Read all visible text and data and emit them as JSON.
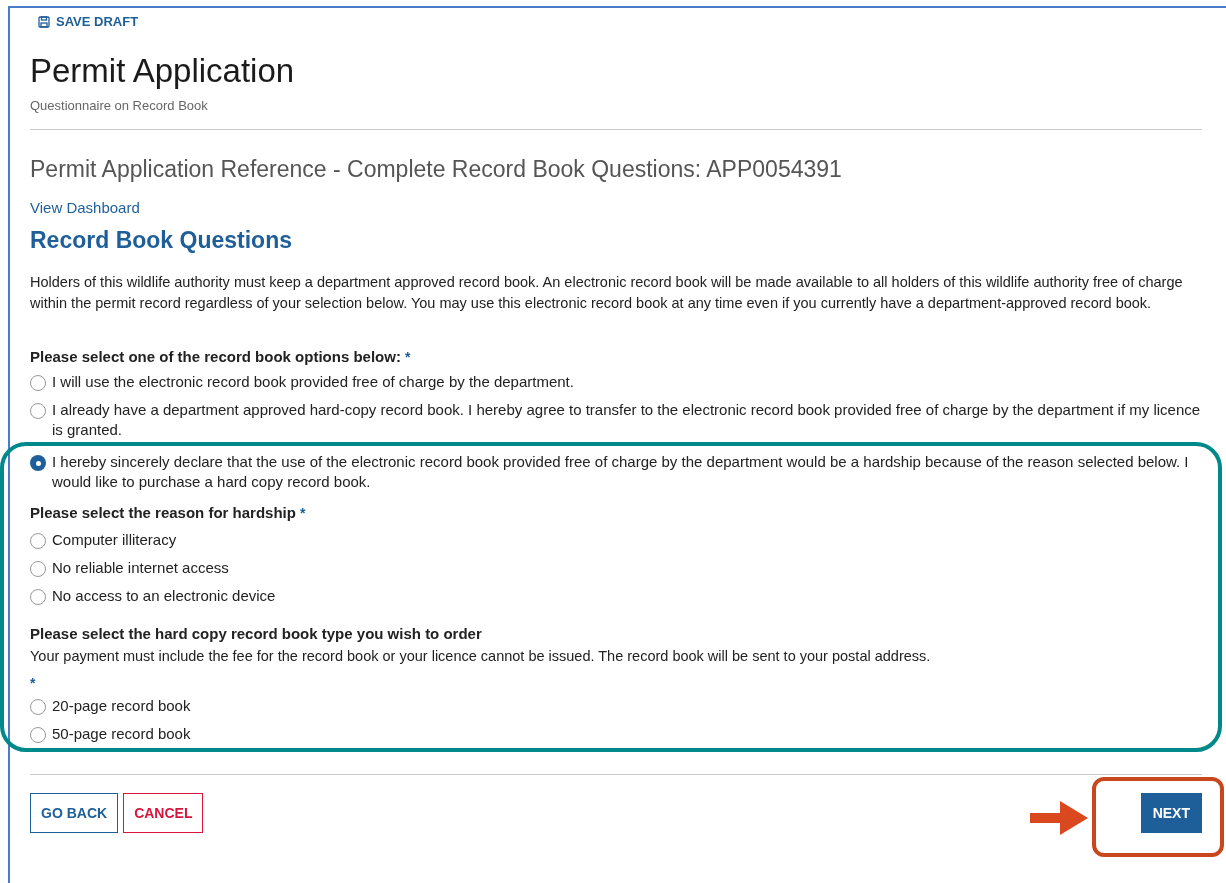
{
  "save_draft": "SAVE DRAFT",
  "title": "Permit Application",
  "subtitle": "Questionnaire on Record Book",
  "reference_heading": "Permit Application Reference - Complete Record Book Questions: APP0054391",
  "dashboard_link": "View Dashboard",
  "section_title": "Record Book Questions",
  "intro": "Holders of this wildlife authority must keep a department approved record book. An electronic record book will be made available to all holders of this wildlife authority free of charge within the permit record regardless of your selection below. You may use this electronic record book at any time even if you currently have a department-approved record book.",
  "record_book_question": {
    "label": "Please select one of the record book options below:",
    "required_mark": "*",
    "options": [
      {
        "label": "I will use the electronic record book provided free of charge by the department.",
        "selected": false
      },
      {
        "label": "I already have a department approved hard-copy record book. I hereby agree to transfer to the electronic record book provided free of charge by the department if my licence is granted.",
        "selected": false
      },
      {
        "label": "I hereby sincerely declare that the use of the electronic record book provided free of charge by the department would be a hardship because of the reason selected below. I would like to purchase a hard copy record book.",
        "selected": true
      }
    ]
  },
  "hardship_question": {
    "label": "Please select the reason for hardship",
    "required_mark": "*",
    "options": [
      {
        "label": "Computer illiteracy",
        "selected": false
      },
      {
        "label": "No reliable internet access",
        "selected": false
      },
      {
        "label": "No access to an electronic device",
        "selected": false
      }
    ]
  },
  "book_type_question": {
    "label": "Please select the hard copy record book type you wish to order",
    "note": "Your payment must include the fee for the record book or your licence cannot be issued. The record book will be sent to your postal address.",
    "required_mark": "*",
    "options": [
      {
        "label": "20-page record book",
        "selected": false
      },
      {
        "label": "50-page record book",
        "selected": false
      }
    ]
  },
  "buttons": {
    "go_back": "GO BACK",
    "cancel": "CANCEL",
    "next": "NEXT"
  }
}
